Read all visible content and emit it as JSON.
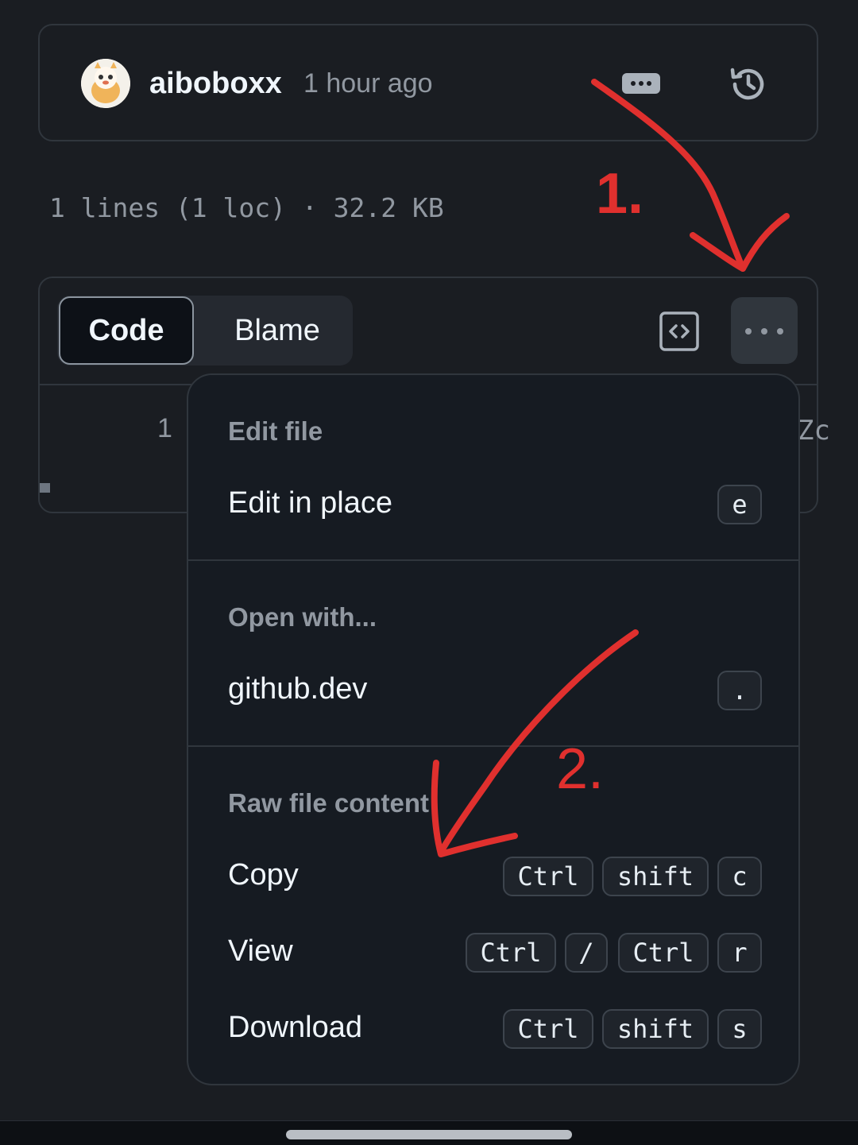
{
  "commit": {
    "author": "aiboboxx",
    "time": "1 hour ago",
    "icons": [
      "avatar",
      "ellipsis-badge-icon",
      "history-icon"
    ]
  },
  "file_meta": "1 lines (1 loc) · 32.2 KB",
  "toolbar": {
    "tab_code": "Code",
    "tab_blame": "Blame",
    "icons": [
      "code-view-icon",
      "kebab-menu-icon"
    ]
  },
  "code": {
    "line_number": "1",
    "fragment": "Zc"
  },
  "menu": {
    "edit_heading": "Edit file",
    "edit_in_place": {
      "label": "Edit in place",
      "keys": [
        "e"
      ]
    },
    "open_heading": "Open with...",
    "github_dev": {
      "label": "github.dev",
      "keys": [
        "."
      ]
    },
    "raw_heading": "Raw file content",
    "copy": {
      "label": "Copy",
      "keys": [
        "Ctrl",
        "shift",
        "c"
      ]
    },
    "view": {
      "label": "View",
      "keys": [
        "Ctrl",
        "/",
        "Ctrl",
        "r"
      ]
    },
    "download": {
      "label": "Download",
      "keys": [
        "Ctrl",
        "shift",
        "s"
      ]
    }
  },
  "annotations": {
    "step1": "1.",
    "step2": "2.",
    "color": "#e0302e"
  }
}
